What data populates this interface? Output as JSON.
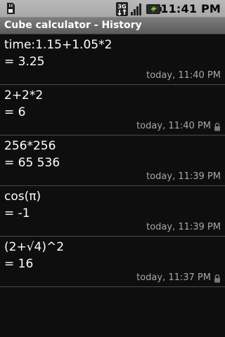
{
  "status_bar": {
    "time": "11:41 PM",
    "network_label": "3G",
    "icons": [
      "sd-card-icon",
      "3g-data-icon",
      "signal-strength-icon",
      "battery-charging-icon"
    ]
  },
  "title_bar": {
    "title": "Cube calculator - History"
  },
  "history": [
    {
      "expression": "time:1.15+1.05*2",
      "result": "= 3.25",
      "timestamp": "today, 11:40 PM",
      "locked": false
    },
    {
      "expression": "2+2*2",
      "result": "= 6",
      "timestamp": "today, 11:40 PM",
      "locked": true
    },
    {
      "expression": "256*256",
      "result": "= 65 536",
      "timestamp": "today, 11:39 PM",
      "locked": false
    },
    {
      "expression": "cos(π)",
      "result": "= -1",
      "timestamp": "today, 11:39 PM",
      "locked": false
    },
    {
      "expression": "(2+√4)^2",
      "result": "= 16",
      "timestamp": "today, 11:37 PM",
      "locked": true
    }
  ],
  "colors": {
    "background": "#0e0e0e",
    "status_bar": "#b0b0b0",
    "title_bar": "#6a6a6a",
    "separator": "#4b4b4b",
    "timestamp": "#a8a8a8",
    "battery_accent": "#7ed321"
  }
}
